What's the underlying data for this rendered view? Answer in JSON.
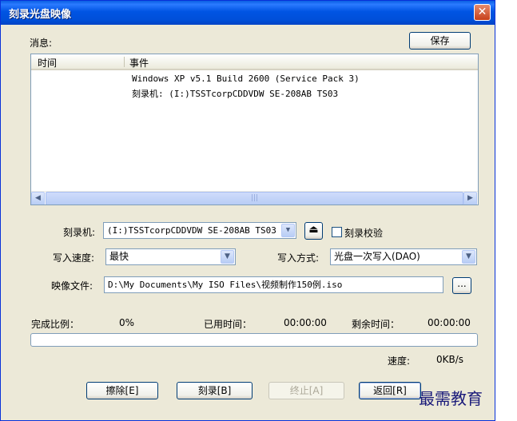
{
  "window": {
    "title": "刻录光盘映像"
  },
  "messages": {
    "label": "消息:",
    "save_button": "保存",
    "columns": [
      "时间",
      "事件"
    ],
    "rows": [
      "Windows XP v5.1 Build 2600 (Service Pack 3)",
      "刻录机: (I:)TSSTcorpCDDVDW SE-208AB TS03"
    ]
  },
  "form": {
    "burner_label": "刻录机:",
    "burner_value": "(I:)TSSTcorpCDDVDW SE-208AB TS03",
    "verify_label": "刻录校验",
    "verify_checked": false,
    "speed_label": "写入速度:",
    "speed_value": "最快",
    "mode_label": "写入方式:",
    "mode_value": "光盘一次写入(DAO)",
    "image_label": "映像文件:",
    "image_value": "D:\\My Documents\\My ISO Files\\视频制作150例.iso",
    "browse_label": "..."
  },
  "progress": {
    "complete_label": "完成比例：",
    "complete_value": "0%",
    "complete_fraction": 0,
    "elapsed_label": "已用时间：",
    "elapsed_value": "00:00:00",
    "remaining_label": "剩余时间：",
    "remaining_value": "00:00:00",
    "speed_label": "速度:",
    "speed_value": "0KB/s"
  },
  "buttons": {
    "erase": "擦除[E]",
    "burn": "刻录[B]",
    "stop": "终止[A]",
    "back": "返回[R]"
  },
  "watermark": "最需教育",
  "colors": {
    "titlebar": "#0054e3",
    "dialog_bg": "#ece9d8",
    "close": "#c7401a"
  }
}
